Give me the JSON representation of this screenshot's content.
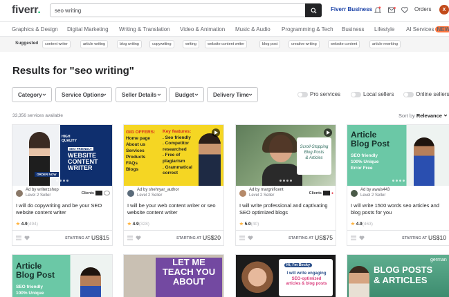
{
  "header": {
    "logo": "fiverr",
    "logo_dot": ".",
    "search_value": "seo writing",
    "business": "Fiverr Business",
    "orders": "Orders",
    "avatar_initial": "X",
    "icons": [
      "search-icon",
      "bell-icon",
      "mail-icon",
      "heart-icon"
    ]
  },
  "categories": [
    "Graphics & Design",
    "Digital Marketing",
    "Writing & Translation",
    "Video & Animation",
    "Music & Audio",
    "Programming & Tech",
    "Business",
    "Lifestyle",
    "AI Services"
  ],
  "new_badge": "NEW",
  "suggested": {
    "label": "Suggested",
    "chips": [
      "content writer",
      "article writing",
      "blog writing",
      "copywriting",
      "writing",
      "website content writer",
      "blog post",
      "creative writing",
      "website content",
      "article rewriting"
    ]
  },
  "results_title": "Results for \"seo writing\"",
  "filters": [
    "Category",
    "Service Options",
    "Seller Details",
    "Budget",
    "Delivery Time"
  ],
  "toggles": [
    "Pro services",
    "Local sellers",
    "Online sellers"
  ],
  "service_count": "33,356 services available",
  "sort": {
    "label": "Sort by",
    "value": "Relevance"
  },
  "gigs": [
    {
      "ad_prefix": "Ad by",
      "seller": "writerzshop",
      "level": "Level 2 Seller",
      "clients_label": "Clients",
      "title": "I will do copywriting and be your SEO website content writer",
      "rating": "4.9",
      "reviews": "(494)",
      "starting": "STARTING AT",
      "price": "US$15",
      "thumb": {
        "quality": "HIGH",
        "quality2": "QUALITY",
        "badge": "SEO FRIENDLY",
        "line1": "WEBSITE",
        "line2": "CONTENT",
        "line3": "WRITER",
        "order": "ORDER NOW"
      }
    },
    {
      "ad_prefix": "Ad by",
      "seller": "shehryar_author",
      "level": "Level 2 Seller",
      "clients_label": "",
      "title": "I will be your web content writer or seo website content writer",
      "rating": "4.9",
      "reviews": "(328)",
      "starting": "STARTING AT",
      "price": "US$20",
      "thumb": {
        "gig_offers": "GIG OFFERS:",
        "offers": [
          "Home page",
          "About us",
          "Services",
          "Products",
          "FAQs",
          "Blogs"
        ],
        "key_features": "Key features:",
        "features": [
          ". Seo friendly",
          ". Competitor",
          "researched",
          ". Free of",
          "plagiarism",
          ". Grammatical",
          "correct"
        ]
      }
    },
    {
      "ad_prefix": "Ad by",
      "seller": "margnificent",
      "level": "Level 2 Seller",
      "clients_label": "Clients",
      "title": "I will write professional and captivating SEO optimized blogs",
      "rating": "5.0",
      "reviews": "(40)",
      "starting": "STARTING AT",
      "price": "US$75",
      "thumb": {
        "lines": [
          "Scroll-Stopping",
          "Blog Posts",
          "& Articles"
        ]
      }
    },
    {
      "ad_prefix": "Ad by",
      "seller": "awais443",
      "level": "Level 2 Seller",
      "clients_label": "",
      "title": "I will write 1500 words seo articles and blog posts for you",
      "rating": "4.9",
      "reviews": "(463)",
      "starting": "STARTING AT",
      "price": "US$10",
      "thumb": {
        "title1": "Article",
        "title2": "Blog Post",
        "features": [
          "SEO friendly",
          "100% Unique",
          "Error Free"
        ]
      }
    }
  ],
  "row2": [
    {
      "title1": "Article",
      "title2": "Blog Post",
      "features": [
        "SEO friendly",
        "100% Unique"
      ]
    },
    {
      "lines": [
        "LET ME",
        "TEACH YOU",
        "ABOUT"
      ]
    },
    {
      "hi": "Hi, I'm Becky",
      "lines": [
        "I will write engaging",
        "SEO-optimized",
        "articles & blog posts"
      ]
    },
    {
      "top": "german",
      "lines": [
        "BLOG POSTS",
        "& ARTICLES"
      ]
    }
  ]
}
